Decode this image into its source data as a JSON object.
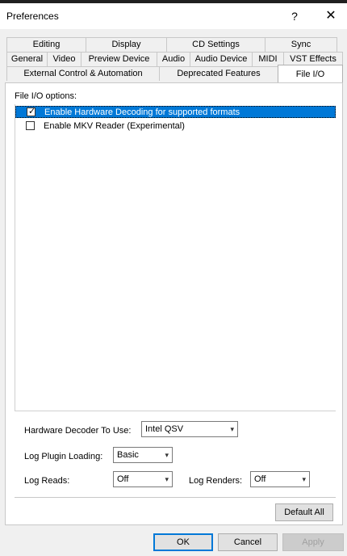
{
  "window": {
    "title": "Preferences",
    "help_glyph": "?",
    "close_glyph": "✕"
  },
  "tabs": {
    "row1": [
      "Editing",
      "Display",
      "CD Settings",
      "Sync"
    ],
    "row2": [
      "General",
      "Video",
      "Preview Device",
      "Audio",
      "Audio Device",
      "MIDI",
      "VST Effects"
    ],
    "row3": [
      "External Control & Automation",
      "Deprecated Features",
      "File I/O"
    ],
    "active": "File I/O"
  },
  "file_io": {
    "label": "File I/O options:",
    "options": [
      {
        "label": "Enable Hardware Decoding for supported formats",
        "checked": true,
        "selected": true
      },
      {
        "label": "Enable MKV Reader (Experimental)",
        "checked": false,
        "selected": false
      }
    ]
  },
  "settings": {
    "hw_decoder": {
      "label": "Hardware Decoder To Use:",
      "value": "Intel QSV"
    },
    "log_plugin": {
      "label": "Log Plugin Loading:",
      "value": "Basic"
    },
    "log_reads": {
      "label": "Log Reads:",
      "value": "Off"
    },
    "log_renders": {
      "label": "Log Renders:",
      "value": "Off"
    }
  },
  "buttons": {
    "default_all": "Default All",
    "ok": "OK",
    "cancel": "Cancel",
    "apply": "Apply"
  },
  "icons": {
    "check_mark": "✓",
    "dropdown_arrow": "▾"
  }
}
